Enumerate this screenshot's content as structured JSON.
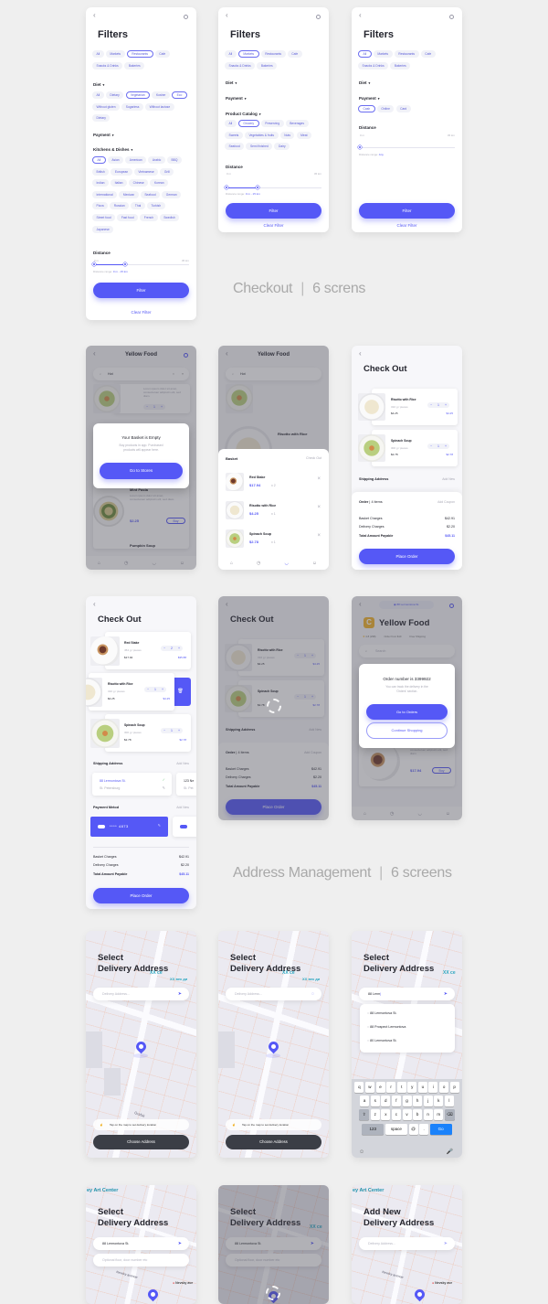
{
  "sections": {
    "checkout": {
      "title": "Checkout",
      "count": "6 screns"
    },
    "address": {
      "title": "Address Management",
      "count": "6 screens"
    }
  },
  "filters": {
    "title": "Filters",
    "categories": [
      "All",
      "Markets",
      "Restaurants",
      "Cafe",
      "Snacks & Drinks",
      "Bakeries"
    ],
    "diet_label": "Diet",
    "diet": [
      "All",
      "Dietary",
      "Vegetarian",
      "Kosher",
      "Eco",
      "Without gluten",
      "Sugarless",
      "Without lactose",
      "Dietary"
    ],
    "payment_label": "Payment",
    "payment": [
      "Cash",
      "Online",
      "Card"
    ],
    "kitchens_label": "Kitchens & Dishes",
    "kitchens": [
      "All",
      "Asian",
      "American",
      "Arabic",
      "BBQ",
      "British",
      "European",
      "Vietnamese",
      "Grill",
      "Indian",
      "Italian",
      "Chinese",
      "Korean",
      "International",
      "Mexican",
      "Seafood",
      "German",
      "Pizza",
      "Russian",
      "Thai",
      "Turkish",
      "Street food",
      "Fast food",
      "French",
      "Swedish",
      "Japanese"
    ],
    "catalog_label": "Product Catalog",
    "catalog": [
      "All",
      "Grocery",
      "Preserving",
      "Beverages",
      "Sweets",
      "Vegetables & fruits",
      "Nuts",
      "Meat",
      "Seafood",
      "Semi finished",
      "Dairy"
    ],
    "distance_label": "Distance",
    "dist_min": "0 m",
    "dist_max": "45 km",
    "range_label": "Distance range:",
    "range_value": "0 m - 15 km",
    "range_any": "Any",
    "range_fraction": 0.33,
    "filter_button": "Filter",
    "clear_filter": "Clear Filter",
    "screen1_selected": [
      "Restaurants",
      "Vegetarian",
      "Eco",
      "All@kitchens"
    ],
    "screen2_selected": [
      "Markets",
      "Grocery"
    ],
    "screen3_selected": [
      "All",
      "Cash"
    ]
  },
  "store": {
    "name": "Yellow Food",
    "search": "Hot",
    "search_placeholder": "Search",
    "address": "88 Lermontova St.",
    "rating": "4.8 (298)",
    "min_order": "Order from $10",
    "shipping": "Free Shipping",
    "lorem": "Lorem ipsum dolor sit amet, consectetuer adipiscin elit, sed diam.",
    "products": [
      {
        "name": "Mint Pasta",
        "price": "$2.25"
      },
      {
        "name": "Pumpkin Soup"
      },
      {
        "name": "Risotto with Rice"
      },
      {
        "name": "Red Stake",
        "price": "$17.94"
      }
    ],
    "buy": "Buy",
    "qty": "1"
  },
  "empty_modal": {
    "title": "Your Basket is Empty",
    "text": "Buy products in app. Purchased products will appear here.",
    "button": "Go to Stores"
  },
  "basket": {
    "title": "Basket",
    "checkout": "Check Out",
    "items": [
      {
        "name": "Red Stake",
        "price": "$17.94",
        "qty": "x 2"
      },
      {
        "name": "Risotto with Rice",
        "price": "$4.25",
        "qty": "x 1"
      },
      {
        "name": "Spinach Soup",
        "price": "$2.78",
        "qty": "x 1"
      }
    ]
  },
  "checkout": {
    "title": "Check Out",
    "items": [
      {
        "name": "Red Stake",
        "weight": "454 g / pieces",
        "price": "$17.94",
        "qty": "2",
        "total": "$35.88"
      },
      {
        "name": "Risotto with Rice",
        "weight": "310 g / pieces",
        "price": "$4.25",
        "qty": "1",
        "total": "$4.25"
      },
      {
        "name": "Spinach Soup",
        "weight": "300 g / pieces",
        "price": "$2.78",
        "qty": "1",
        "total": "$2.78"
      }
    ],
    "shipping_label": "Shipping Address",
    "add_new": "Add New",
    "addresses": [
      {
        "street": "88 Lermontova St.",
        "city": "St. Petersburg"
      },
      {
        "street": "123 Ne",
        "city": "St. Pet"
      }
    ],
    "payment_label": "Payment Metod",
    "card": "**** 4873",
    "order_label": "Order",
    "order_items": "4 items",
    "add_coupon": "Add Coupon",
    "basket_charges_label": "Basket Charges",
    "basket_charges": "$42.91",
    "delivery_label": "Delivery Charges",
    "delivery": "$2.20",
    "total_label": "Total Amount Payable",
    "total": "$45.11",
    "place_order": "Place Order"
  },
  "order_modal": {
    "title": "Order number is 3399922",
    "text": "You can track the delivery in the 'Orders' section.",
    "go": "Go to Orders",
    "continue": "Continue Shopping"
  },
  "address": {
    "select_title_1": "Select",
    "select_title_2": "Delivery Address",
    "add_title_1": "Add New",
    "placeholder": "Delivery Address...",
    "typed": "88 Lerm",
    "selected": "88 Lermontova St.",
    "optional_placeholder": "Optional floor, door number etc",
    "hint": "Tap on the map to set delivery location",
    "choose": "Choose Address",
    "suggestions": [
      "88 Lermontova St.",
      "88 Prospect Lermontova",
      "80 Lermontova St."
    ],
    "map_labels": {
      "xx1": "XX ce",
      "xx2": "XX век ди",
      "art": "ey Art Center",
      "nevsky": "Nevsky avenue",
      "nevsky2": "Nevsky ave",
      "grafsky": "Grafsk"
    }
  },
  "keyboard": {
    "row1": [
      "q",
      "w",
      "e",
      "r",
      "t",
      "y",
      "u",
      "i",
      "o",
      "p"
    ],
    "row2": [
      "a",
      "s",
      "d",
      "f",
      "g",
      "h",
      "j",
      "k",
      "l"
    ],
    "row3": [
      "z",
      "x",
      "c",
      "v",
      "b",
      "n",
      "m"
    ],
    "num": "123",
    "space": "space",
    "at": "@",
    "dot": ".",
    "go": "Go"
  }
}
